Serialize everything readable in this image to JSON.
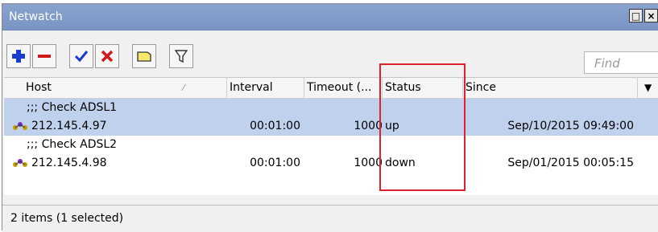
{
  "window": {
    "title": "Netwatch"
  },
  "titlebar": {
    "restore_label": "□",
    "close_label": "×"
  },
  "toolbar": {
    "find_placeholder": "Find"
  },
  "table": {
    "columns": [
      {
        "label": "Host",
        "sort_indicator": "⁄"
      },
      {
        "label": "Interval"
      },
      {
        "label": "Timeout (..."
      },
      {
        "label": "Status"
      },
      {
        "label": "Since"
      }
    ],
    "dropdown_glyph": "▼",
    "rows": [
      {
        "type": "comment",
        "text": ";;; Check ADSL1"
      },
      {
        "type": "data",
        "selected": true,
        "host": "212.145.4.97",
        "interval": "00:01:00",
        "timeout": "1000",
        "status": "up",
        "since": "Sep/10/2015 09:49:00"
      },
      {
        "type": "comment",
        "text": ";;; Check ADSL2"
      },
      {
        "type": "data",
        "selected": false,
        "host": "212.145.4.98",
        "interval": "00:01:00",
        "timeout": "1000",
        "status": "down",
        "since": "Sep/01/2015 00:05:15"
      }
    ]
  },
  "statusbar": {
    "text": "2 items (1 selected)"
  },
  "colors": {
    "selected_row": "#bfd1ec",
    "title_bar": "#8aa3ce",
    "highlight": "#e0202a"
  }
}
